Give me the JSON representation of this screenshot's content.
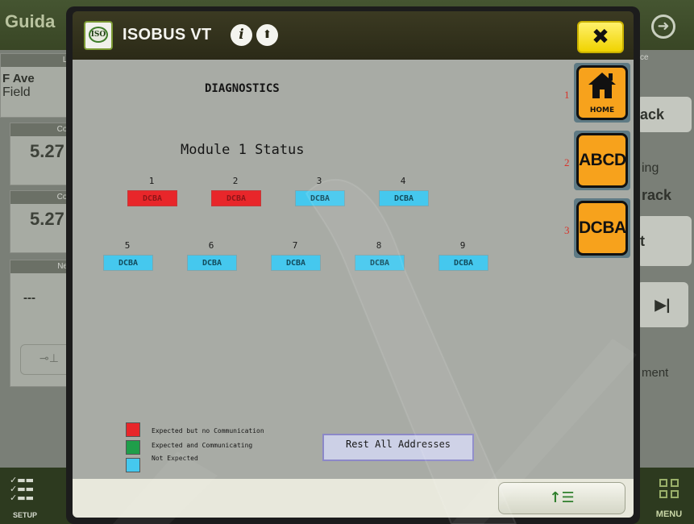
{
  "background": {
    "title": "Guida",
    "left_cards": [
      {
        "header": "Lo",
        "line1": "F Ave",
        "line2": "Field"
      },
      {
        "header": "Cou",
        "value": "5.27"
      },
      {
        "header": "Cou",
        "value": "5.27"
      },
      {
        "header": "Nex",
        "value": "---"
      }
    ],
    "right_buttons": [
      "ack",
      "ing",
      "rack",
      "t",
      "ment"
    ],
    "right_header": "ce",
    "setup_label": "SETUP",
    "menu_label": "MENU"
  },
  "modal": {
    "title": "ISOBUS VT",
    "logo_text": "ISO",
    "info_icon_glyph": "i",
    "info2_icon_glyph": "⬆",
    "close_glyph": "✖",
    "screen_title": "DIAGNOSTICS",
    "module_status": "Module 1 Status",
    "addresses_row1": [
      {
        "num": "1",
        "label": "DCBA",
        "status": "red"
      },
      {
        "num": "2",
        "label": "DCBA",
        "status": "red"
      },
      {
        "num": "3",
        "label": "DCBA",
        "status": "cyan"
      },
      {
        "num": "4",
        "label": "DCBA",
        "status": "cyan"
      }
    ],
    "addresses_row2": [
      {
        "num": "5",
        "label": "DCBA",
        "status": "cyan"
      },
      {
        "num": "6",
        "label": "DCBA",
        "status": "cyan"
      },
      {
        "num": "7",
        "label": "DCBA",
        "status": "cyan"
      },
      {
        "num": "8",
        "label": "DCBA",
        "status": "cyan"
      },
      {
        "num": "9",
        "label": "DCBA",
        "status": "cyan"
      }
    ],
    "legend": [
      {
        "text": "Expected but no Communication",
        "color": "#e8262a"
      },
      {
        "text": "Expected and Communicating",
        "color": "#1f9e4a"
      },
      {
        "text": "Not Expected",
        "color": "#45c8ee"
      }
    ],
    "reset_button": "Rest All Addresses",
    "softkeys": [
      {
        "num": "1",
        "label": "HOME",
        "icon": "home-icon"
      },
      {
        "num": "2",
        "label": "ABCD"
      },
      {
        "num": "3",
        "label": "DCBA"
      }
    ],
    "footer_button_glyph": "↑☰"
  },
  "colors": {
    "red": "#e8262a",
    "cyan": "#45c8ee",
    "softkey": "#f7a21c",
    "close": "#f5e000"
  }
}
